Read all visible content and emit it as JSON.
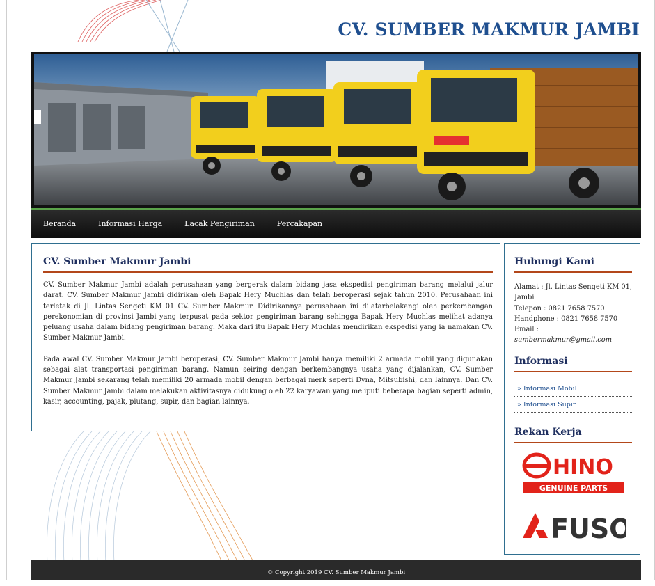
{
  "header": {
    "site_title": "CV. SUMBER MAKMUR JAMBI"
  },
  "nav": {
    "items": [
      {
        "label": "Beranda"
      },
      {
        "label": "Informasi Harga"
      },
      {
        "label": "Lacak Pengiriman"
      },
      {
        "label": "Percakapan"
      }
    ]
  },
  "main": {
    "title": "CV. Sumber Makmur Jambi",
    "paragraphs": [
      "CV. Sumber Makmur Jambi adalah perusahaan yang bergerak dalam bidang jasa ekspedisi pengiriman barang melalui jalur darat. CV. Sumber Makmur Jambi didirikan oleh Bapak Hery Muchlas dan telah beroperasi sejak tahun 2010. Perusahaan ini terletak di Jl. Lintas Sengeti KM 01 CV. Sumber Makmur. Didirikannya perusahaan ini dilatarbelakangi oleh perkembangan perekonomian di provinsi Jambi yang terpusat pada sektor pengiriman barang sehingga Bapak Hery Muchlas melihat adanya peluang usaha dalam bidang pengiriman barang. Maka dari itu Bapak Hery Muchlas mendirikan ekspedisi yang ia namakan CV. Sumber Makmur Jambi.",
      "Pada awal CV. Sumber Makmur Jambi beroperasi, CV. Sumber Makmur Jambi hanya memiliki 2 armada mobil yang digunakan sebagai alat transportasi pengiriman barang. Namun seiring dengan berkembangnya usaha yang dijalankan, CV. Sumber Makmur Jambi sekarang telah memiliki 20 armada mobil dengan berbagai merk seperti Dyna, Mitsubishi, dan lainnya. Dan CV. Sumber Makmur Jambi dalam melakukan aktivitasnya didukung oleh 22 karyawan yang meliputi beberapa bagian seperti admin, kasir, accounting, pajak, piutang, supir, dan bagian lainnya."
    ]
  },
  "sidebar": {
    "contact_title": "Hubungi Kami",
    "contact": {
      "alamat": "Alamat : Jl. Lintas Sengeti KM 01, Jambi",
      "telepon": "Telepon : 0821 7658 7570",
      "handphone": "Handphone : 0821 7658 7570",
      "email_label": "Email : ",
      "email": "sumbermakmur@gmail.com"
    },
    "info_title": "Informasi",
    "info_links": [
      {
        "label": "» Informasi Mobil"
      },
      {
        "label": "» Informasi Supir"
      }
    ],
    "partners_title": "Rekan Kerja",
    "partners": {
      "hino_word": "HINO",
      "hino_sub": "GENUINE PARTS",
      "fuso_word": "FUSO"
    }
  },
  "footer": {
    "copyright": "© Copyright 2019 CV. Sumber Makmur Jambi"
  },
  "colors": {
    "title_blue": "#1f4f8f",
    "heading_navy": "#1f2f5f",
    "accent_rule": "#b3471a",
    "nav_green": "#5aa34a",
    "truck_yellow": "#f2cf1d",
    "hino_red": "#e2231a",
    "fuso_grey": "#333333"
  }
}
